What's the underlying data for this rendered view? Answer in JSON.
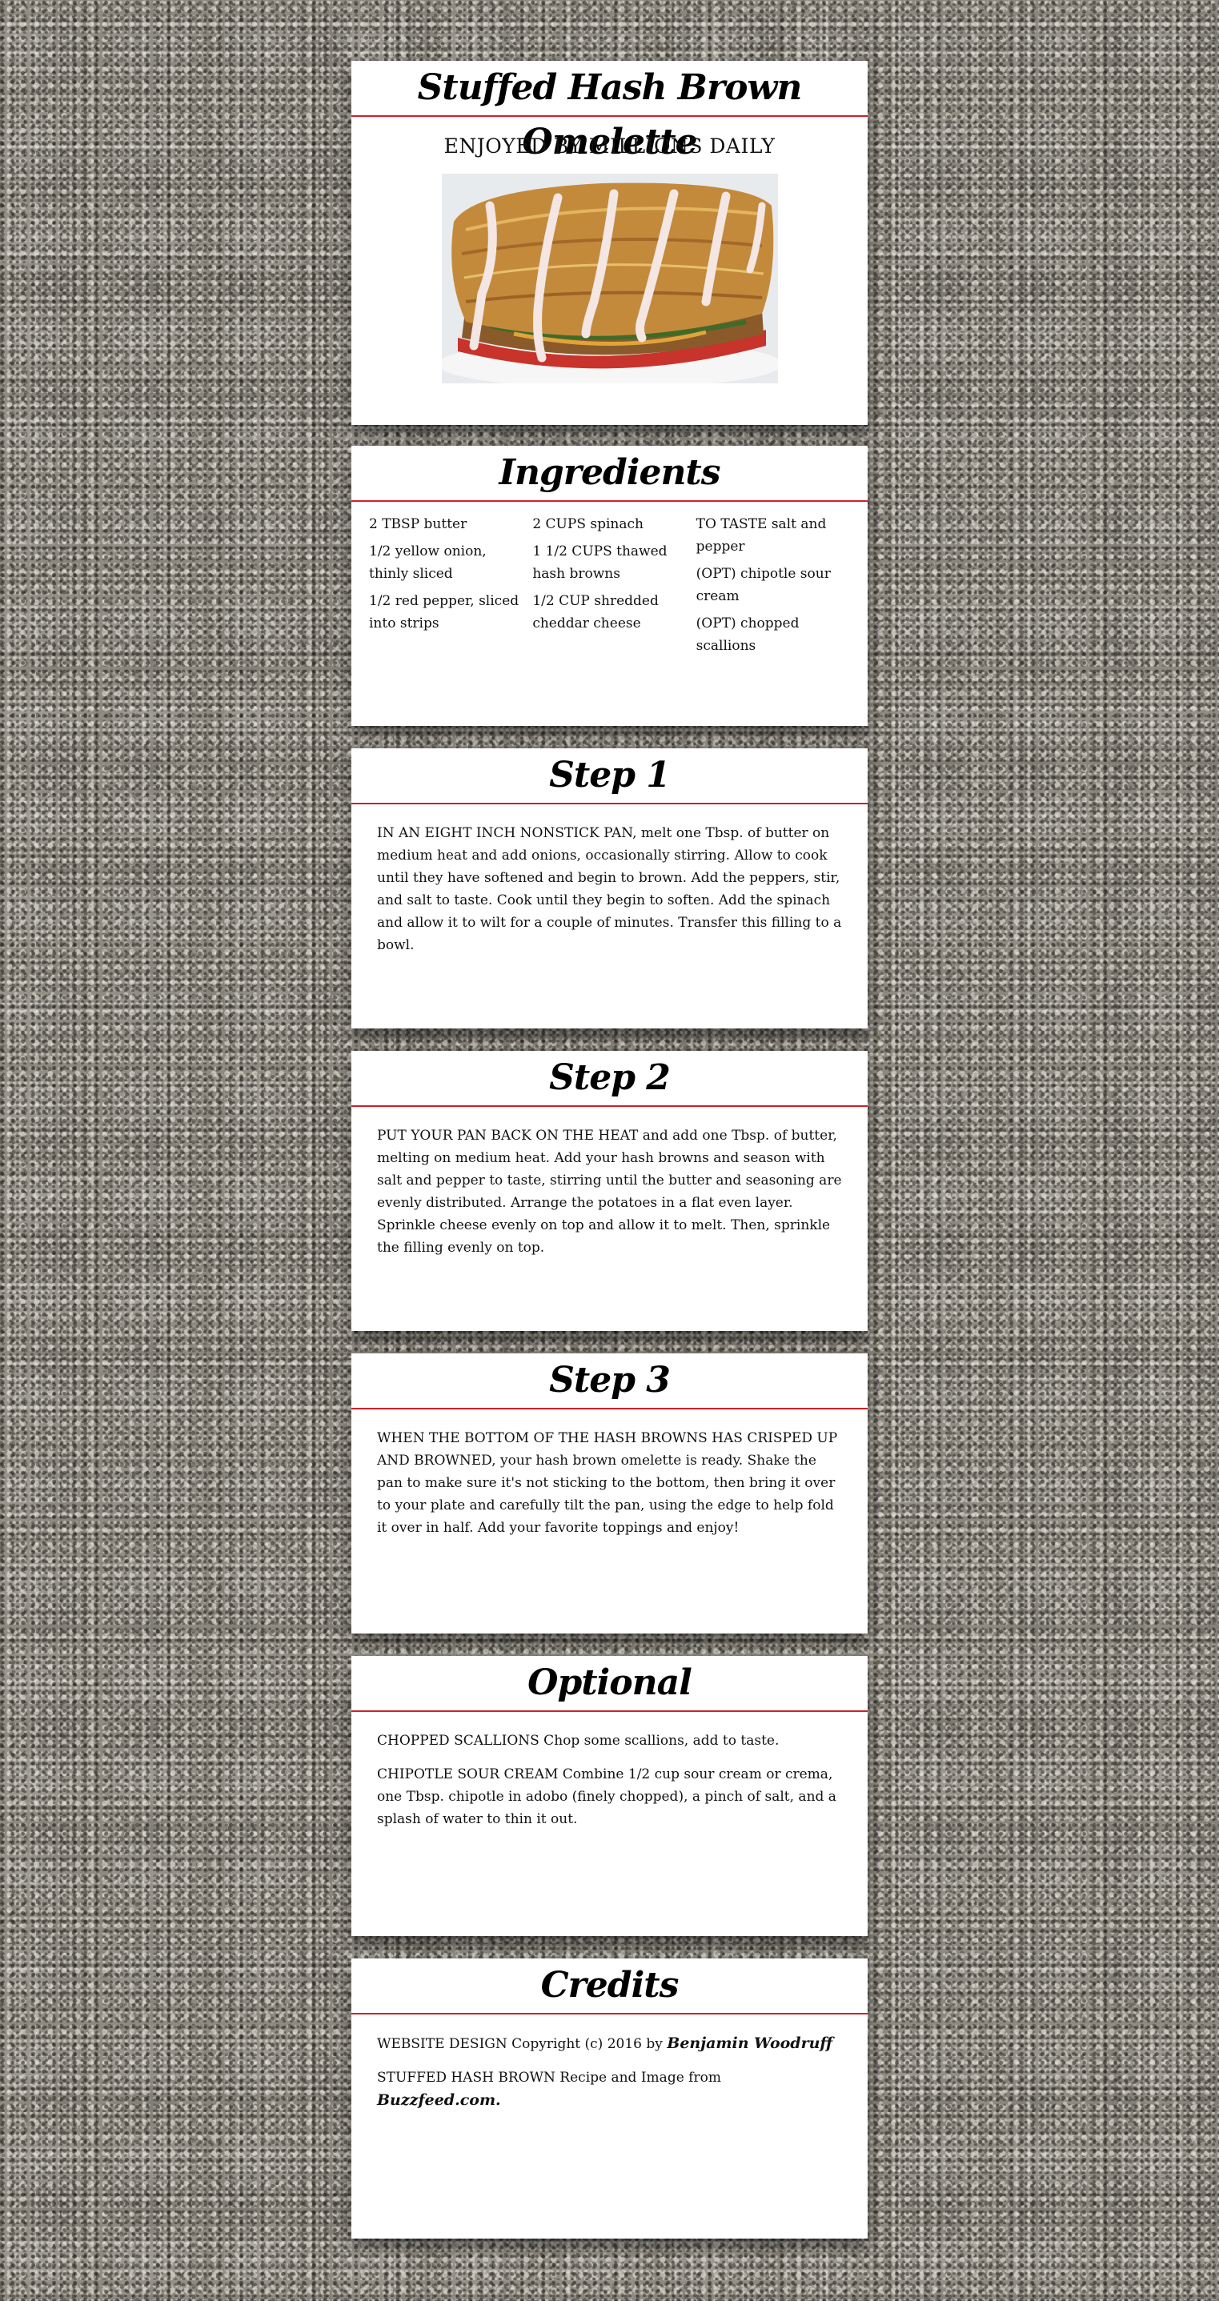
{
  "hero": {
    "title": "Stuffed Hash Brown Omelette",
    "tagline": "ENJOYED BY MILLIONS DAILY",
    "image_alt": "Stuffed hash brown omelette drizzled with chipotle sour cream"
  },
  "ingredients": {
    "title": "Ingredients",
    "columns": [
      [
        {
          "amount": "2 TBSP",
          "item": " butter"
        },
        {
          "amount": "1/2",
          "item": " yellow onion, thinly sliced"
        },
        {
          "amount": "1/2",
          "item": " red pepper, sliced into strips"
        }
      ],
      [
        {
          "amount": "2 CUPS",
          "item": " spinach"
        },
        {
          "amount": "1 1/2 CUPS",
          "item": " thawed hash browns"
        },
        {
          "amount": "1/2 CUP",
          "item": " shredded cheddar cheese"
        }
      ],
      [
        {
          "amount": "TO TASTE",
          "item": " salt and pepper"
        },
        {
          "amount": "(OPT)",
          "item": " chipotle sour cream"
        },
        {
          "amount": "(OPT)",
          "item": " chopped scallions"
        }
      ]
    ]
  },
  "steps": [
    {
      "title": "Step 1",
      "lead": "In an eight inch nonstick pan,",
      "text": " melt one Tbsp. of butter on medium heat and add onions, occasionally stirring. Allow to cook until they have softened and begin to brown. Add the peppers, stir, and salt to taste. Cook until they begin to soften. Add the spinach and allow it to wilt for a couple of minutes. Transfer this filling to a bowl."
    },
    {
      "title": "Step 2",
      "lead": "Put your pan back on the heat",
      "text": " and add one Tbsp. of butter, melting on medium heat. Add your hash browns and season with salt and pepper to taste, stirring until the butter and seasoning are evenly distributed. Arrange the potatoes in a flat even layer. Sprinkle cheese evenly on top and allow it to melt. Then, sprinkle the filling evenly on top."
    },
    {
      "title": "Step 3",
      "lead": "When the bottom of the hash browns has crisped up and browned,",
      "text": " your hash brown omelette is ready. Shake the pan to make sure it's not sticking to the bottom, then bring it over to your plate and carefully tilt the pan, using the edge to help fold it over in half. Add your favorite toppings and enjoy!"
    }
  ],
  "optional": {
    "title": "Optional",
    "items": [
      {
        "lead": "Chopped scallions",
        "text": " Chop some scallions, add to taste."
      },
      {
        "lead": "Chipotle sour cream",
        "text": " Combine 1/2 cup sour cream or crema, one Tbsp. chipotle in adobo (finely chopped), a pinch of salt, and a splash of water to thin it out."
      }
    ]
  },
  "credits": {
    "title": "Credits",
    "design_lead": "Website design",
    "design_text": " Copyright (c) 2016 by ",
    "design_name": "Benjamin Woodruff",
    "recipe_lead": "Stuffed hash brown",
    "recipe_text": " Recipe and Image from ",
    "recipe_source": "Buzzfeed.com."
  },
  "colors": {
    "accent_rule": "#d0202a",
    "card_bg": "#ffffff"
  }
}
